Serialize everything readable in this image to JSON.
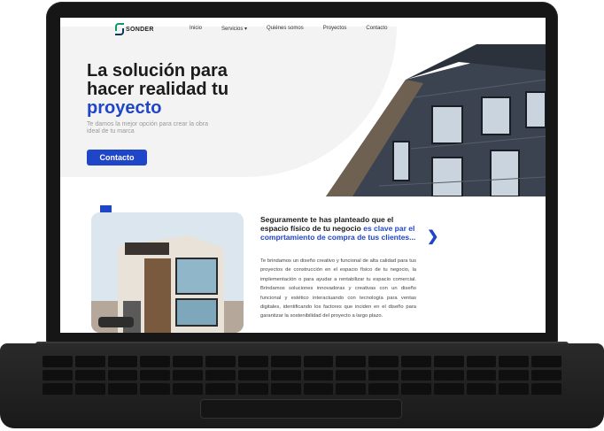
{
  "nav": {
    "logo_text": "SONDER",
    "items": [
      "Inicio",
      "Servicios ▾",
      "Quiénes somos",
      "Proyectos",
      "Contacto"
    ]
  },
  "hero": {
    "title_line1": "La solución para",
    "title_line2": "hacer realidad tu",
    "title_accent": "proyecto",
    "subtitle": "Te damos la mejor opción para crear la obra ideal de tu marca",
    "cta_label": "Contacto"
  },
  "section": {
    "title_part1": "Seguramente te has planteado que el espacio físico de tu negocio",
    "title_accent": "es clave par el comprtamiento de compra de tus clientes...",
    "body": "Te brindamos un diseño creativo y funcional de alta calidad para tus proyectos de construcción en el espacio físico de tu negocio, la implementación o para ayudar a rentabilizar tu espacio comercial. Brindamos soluciones innovadoras y creativas con un diseño funcional y estético interactuando con tecnología para ventas digitales, identificando los factores que inciden en el diseño para garantizar la sostenibilidad del proyecto a largo plazo.",
    "arrow_icon": "chevron-right-icon"
  },
  "colors": {
    "accent": "#1f45c8",
    "logo_green": "#0b9a6a"
  }
}
